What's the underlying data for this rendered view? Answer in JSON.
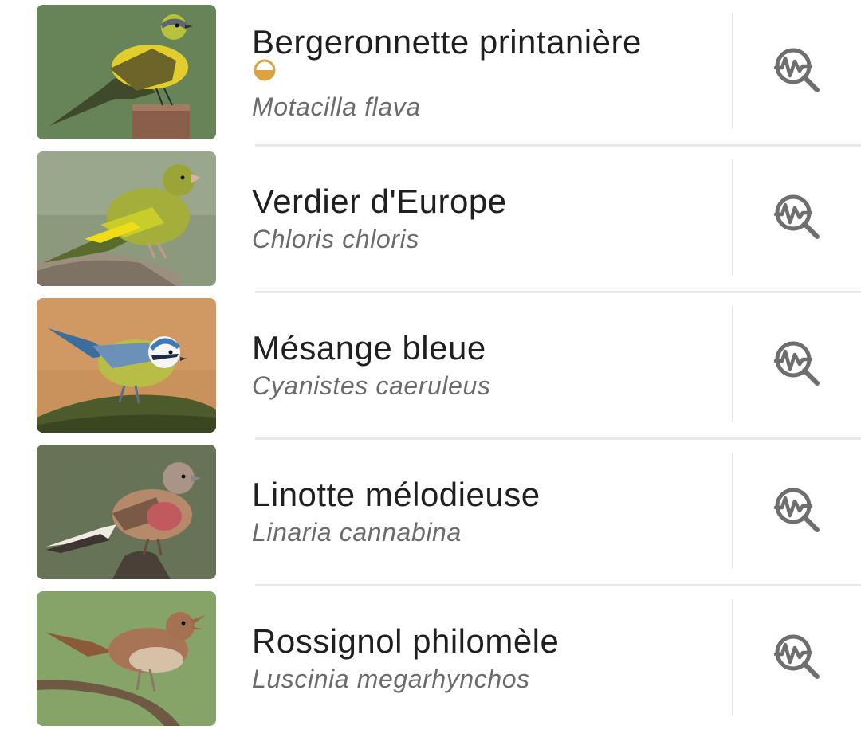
{
  "species_list": [
    {
      "common_name": "Bergeronnette printanière",
      "scientific_name": "Motacilla flava",
      "photo_icon": "yellow-wagtail-photo",
      "status_icon": "half-filled-circle-icon",
      "status_color": "#D9A441",
      "action_icon": "sonogram-search-icon"
    },
    {
      "common_name": "Verdier d'Europe",
      "scientific_name": "Chloris chloris",
      "photo_icon": "greenfinch-photo",
      "action_icon": "sonogram-search-icon"
    },
    {
      "common_name": "Mésange bleue",
      "scientific_name": "Cyanistes caeruleus",
      "photo_icon": "blue-tit-photo",
      "action_icon": "sonogram-search-icon"
    },
    {
      "common_name": "Linotte mélodieuse",
      "scientific_name": "Linaria cannabina",
      "photo_icon": "linnet-photo",
      "action_icon": "sonogram-search-icon"
    },
    {
      "common_name": "Rossignol philomèle",
      "scientific_name": "Luscinia megarhynchos",
      "photo_icon": "nightingale-photo",
      "action_icon": "sonogram-search-icon"
    }
  ],
  "colors": {
    "primary_text": "#1F1F1F",
    "secondary_text": "#6B6B6B",
    "icon": "#6E6E6E",
    "divider": "#E8E8E8",
    "status_accent": "#D9A441"
  }
}
